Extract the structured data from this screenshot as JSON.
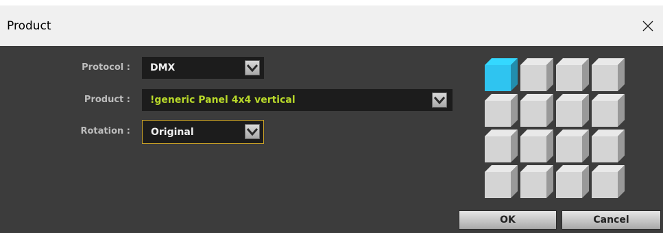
{
  "window": {
    "title": "Product"
  },
  "form": {
    "protocol": {
      "label": "Protocol :",
      "value": "DMX"
    },
    "product": {
      "label": "Product :",
      "value": "!generic Panel 4x4 vertical"
    },
    "rotation": {
      "label": "Rotation :",
      "value": "Original"
    }
  },
  "preview": {
    "rows": 4,
    "cols": 4,
    "active_cell": 0,
    "active_color": "#2fc4f0",
    "cell_color": "#d4d4d4"
  },
  "buttons": {
    "ok": "OK",
    "cancel": "Cancel"
  },
  "colors": {
    "product_text": "#b8d82a",
    "focus_border": "#c9a227"
  }
}
